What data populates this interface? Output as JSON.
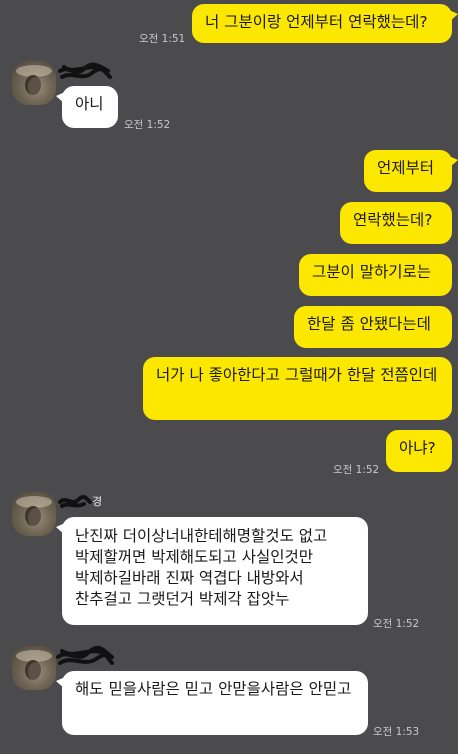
{
  "messages": {
    "m1": {
      "text": "너 그분이랑 언제부터 연락했는데?",
      "time": "오전 1:51"
    },
    "m2": {
      "text": "아니",
      "time": "오전 1:52"
    },
    "m3": {
      "text": "언제부터"
    },
    "m4": {
      "text": "연락했는데?"
    },
    "m5": {
      "text": "그분이 말하기로는"
    },
    "m6": {
      "text": "한달 좀 안됐다는데"
    },
    "m7": {
      "text": "너가 나 좋아한다고 그럴때가 한달 전쯤인데"
    },
    "m8": {
      "text": "아냐?",
      "time": "오전 1:52"
    },
    "m9": {
      "text": "난진짜 더이상너내한테해명할것도 없고 박제할꺼면 박제해도되고 사실인것만 박제하길바래 진짜 역겹다 내방와서 찬추걸고 그랫던거 박제각 잡앗누",
      "time": "오전 1:52"
    },
    "m10": {
      "text": "해도 믿을사람은 믿고 안맏을사람은 안믿고",
      "time": "오전 1:53"
    }
  },
  "sender": {
    "name_fragment": "경"
  },
  "colors": {
    "background": "#4b4b4d",
    "outgoing_bubble": "#fce700",
    "incoming_bubble": "#ffffff",
    "timestamp": "#c9c9c9"
  },
  "icons": {
    "avatar": "profile-photo-avatar",
    "redaction": "scribbled-out-name"
  }
}
